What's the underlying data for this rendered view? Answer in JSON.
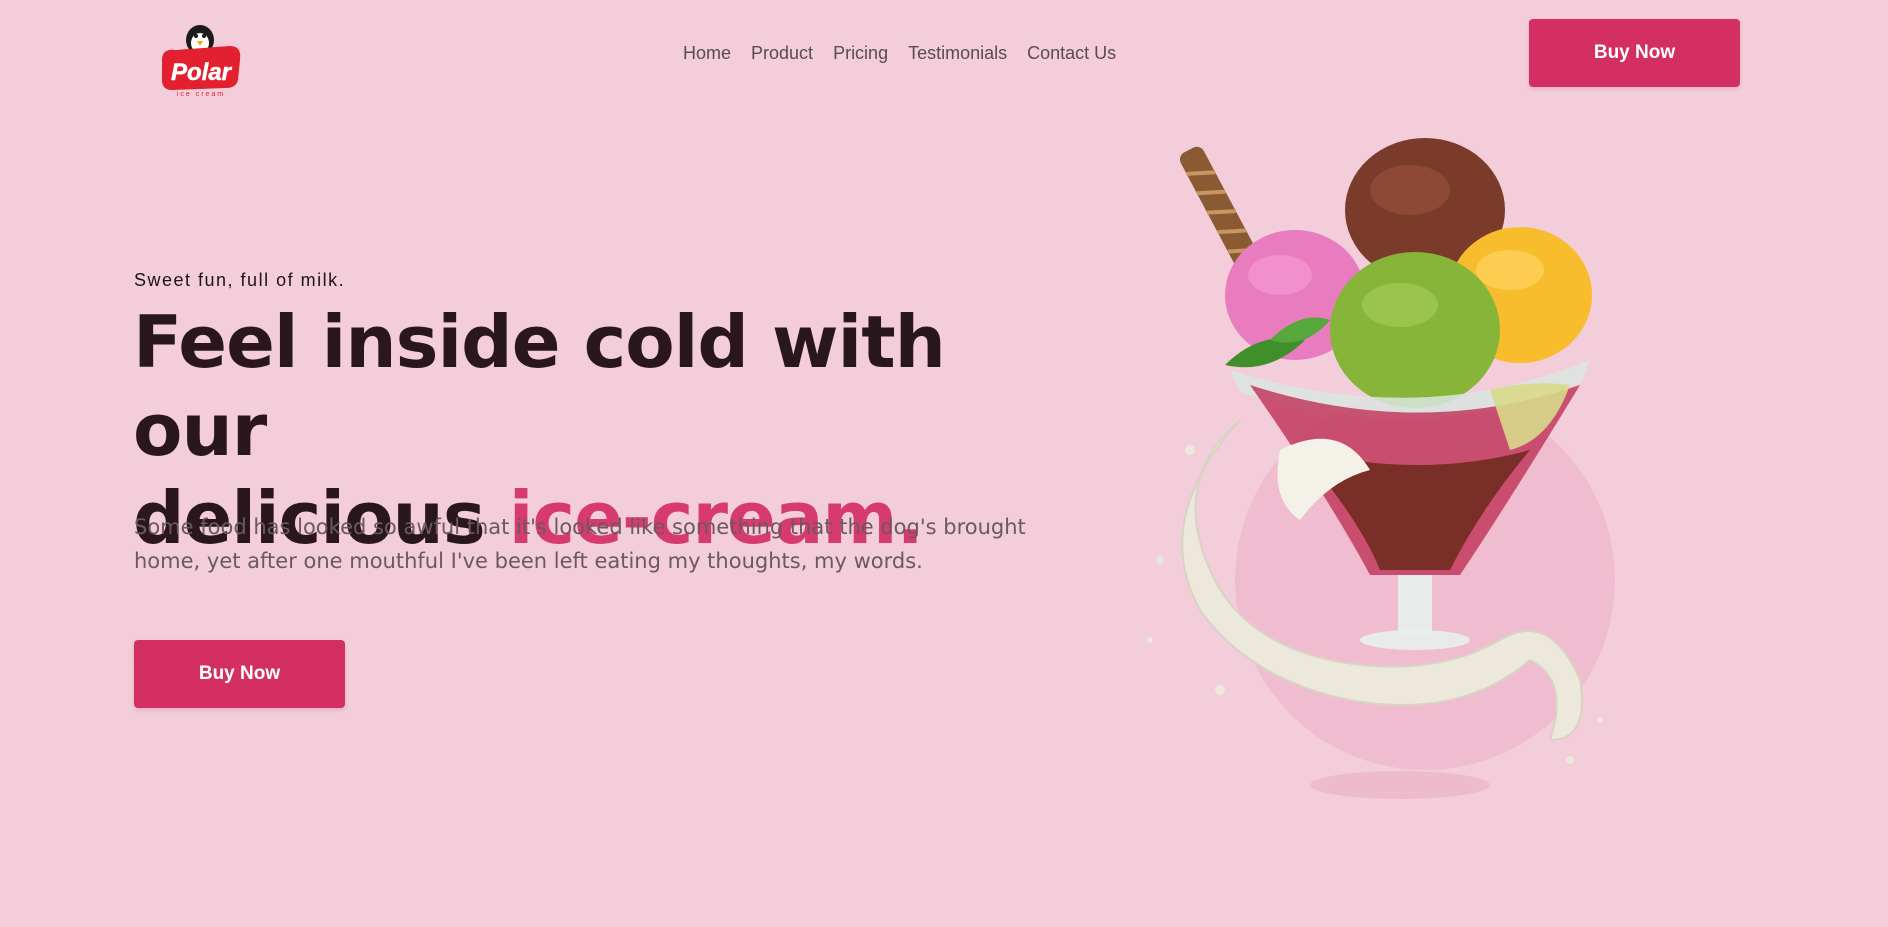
{
  "brand": {
    "logo_text": "Polar",
    "logo_subtext": "ice cream",
    "logo_color": "#e2202f"
  },
  "nav": {
    "items": [
      {
        "label": "Home"
      },
      {
        "label": "Product"
      },
      {
        "label": "Pricing"
      },
      {
        "label": "Testimonials"
      },
      {
        "label": "Contact Us"
      }
    ]
  },
  "header": {
    "cta_label": "Buy Now"
  },
  "hero": {
    "eyebrow": "Sweet fun, full of milk.",
    "headline_line1": "Feel inside cold with our",
    "headline_line2_plain": "delicious ",
    "headline_line2_accent": "ice-cream.",
    "description": "Some food has looked so awful that it's looked like something that the dog's brought home, yet after one mouthful I've been left eating my thoughts, my words.",
    "cta_label": "Buy Now",
    "illustration": "ice-cream-sundae-illustration"
  },
  "colors": {
    "background": "#f3cdda",
    "accent": "#d32f63",
    "headline": "#2a171d",
    "accent_text": "#d73a6e"
  }
}
